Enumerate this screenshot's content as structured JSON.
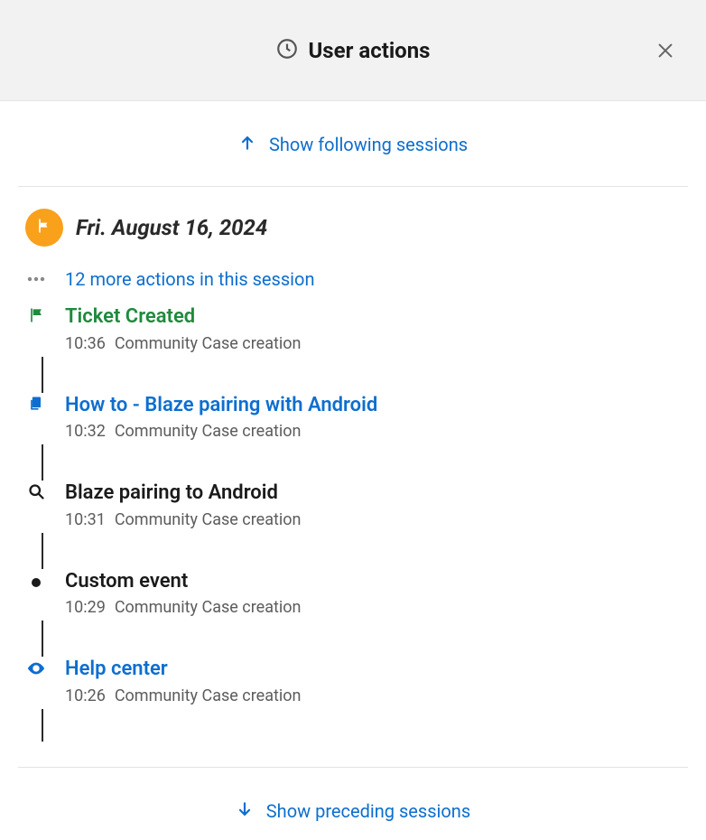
{
  "header": {
    "title": "User actions"
  },
  "showFollowing": "Show following sessions",
  "showPreceding": "Show preceding sessions",
  "session": {
    "date": "Fri. August 16, 2024",
    "moreActions": "12 more actions in this session"
  },
  "events": [
    {
      "title": "Ticket Created",
      "time": "10:36",
      "subtitle": "Community Case creation",
      "style": "green",
      "icon": "flag"
    },
    {
      "title": "How to - Blaze pairing with Android",
      "time": "10:32",
      "subtitle": "Community Case creation",
      "style": "blue",
      "icon": "doc"
    },
    {
      "title": "Blaze pairing to Android",
      "time": "10:31",
      "subtitle": "Community Case creation",
      "style": "black",
      "icon": "search"
    },
    {
      "title": "Custom event",
      "time": "10:29",
      "subtitle": "Community Case creation",
      "style": "black",
      "icon": "dot"
    },
    {
      "title": "Help center",
      "time": "10:26",
      "subtitle": "Community Case creation",
      "style": "blue",
      "icon": "eye"
    }
  ]
}
